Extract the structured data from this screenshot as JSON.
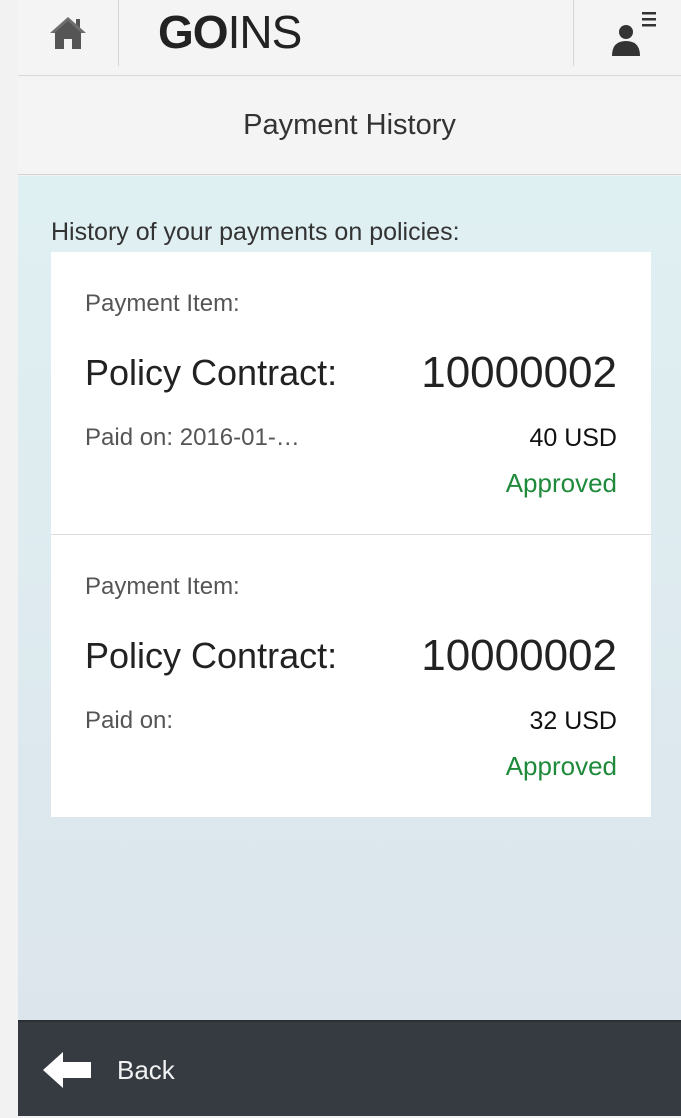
{
  "header": {
    "logo_bold": "GO",
    "logo_rest": "INS"
  },
  "title": "Payment History",
  "intro": "History of your payments on policies:",
  "payments": [
    {
      "item_label": "Payment Item:",
      "policy_label": "Policy Contract:",
      "policy_number": "10000002",
      "paid_on": "Paid on: 2016-01-…",
      "amount": "40 USD",
      "status": "Approved"
    },
    {
      "item_label": "Payment Item:",
      "policy_label": "Policy Contract:",
      "policy_number": "10000002",
      "paid_on": "Paid on:",
      "amount": "32 USD",
      "status": "Approved"
    }
  ],
  "footer": {
    "back_label": "Back"
  },
  "colors": {
    "status_approved": "#1f8a3b",
    "footer_bg": "#363b41",
    "content_bg": "#dff0f2"
  },
  "icons": {
    "home": "home-icon",
    "user": "user-menu-icon",
    "back": "arrow-left-icon"
  }
}
